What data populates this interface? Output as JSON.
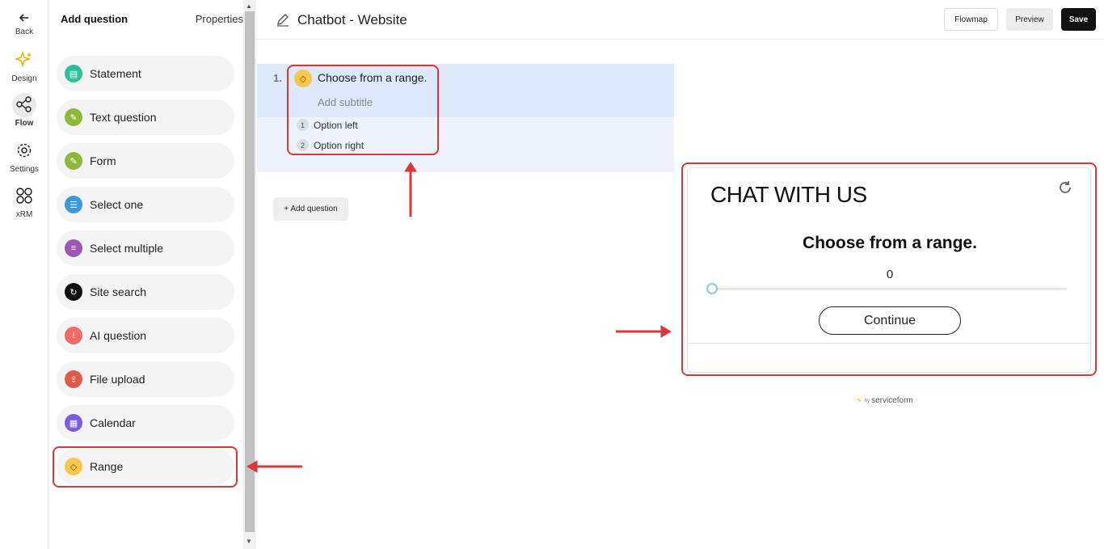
{
  "rail": {
    "back": "Back",
    "design": "Design",
    "flow": "Flow",
    "settings": "Settings",
    "xrm": "xRM"
  },
  "panel": {
    "tab_add": "Add question",
    "tab_properties": "Properties",
    "types": [
      {
        "label": "Statement",
        "color": "#2bbf9d",
        "icon": "clipboard-icon"
      },
      {
        "label": "Text question",
        "color": "#8fb83a",
        "icon": "pencil-icon"
      },
      {
        "label": "Form",
        "color": "#8fb83a",
        "icon": "pencil-icon"
      },
      {
        "label": "Select one",
        "color": "#3a9ad9",
        "icon": "list-icon"
      },
      {
        "label": "Select multiple",
        "color": "#9b59b6",
        "icon": "lines-icon"
      },
      {
        "label": "Site search",
        "color": "#111111",
        "icon": "refresh-icon"
      },
      {
        "label": "AI question",
        "color": "#f06a6a",
        "icon": "chat-icon"
      },
      {
        "label": "File upload",
        "color": "#e05a4a",
        "icon": "upload-icon"
      },
      {
        "label": "Calendar",
        "color": "#7b5ce0",
        "icon": "calendar-icon"
      },
      {
        "label": "Range",
        "color": "#f7c64d",
        "icon": "diamond-icon"
      }
    ]
  },
  "header": {
    "title": "Chatbot - Website",
    "flowmap": "Flowmap",
    "preview": "Preview",
    "save": "Save"
  },
  "question": {
    "number": "1.",
    "title": "Choose from a range.",
    "subtitle_placeholder": "Add subtitle",
    "options": [
      {
        "n": "1",
        "label": "Option left"
      },
      {
        "n": "2",
        "label": "Option right"
      }
    ]
  },
  "add_question": "+ Add question",
  "widget": {
    "title": "CHAT WITH US",
    "question": "Choose from a range.",
    "value": "0",
    "continue": "Continue",
    "brand_by": "by",
    "brand": "serviceform"
  },
  "colors": {
    "highlight": "#d93838",
    "accent": "#111111"
  }
}
